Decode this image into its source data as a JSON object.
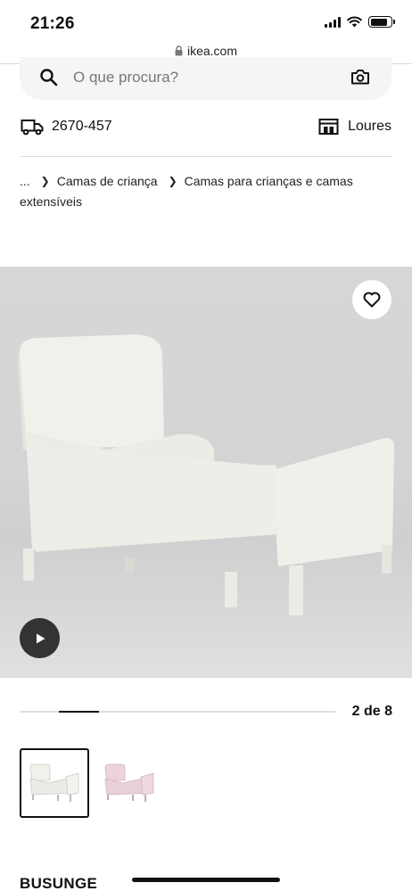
{
  "status_bar": {
    "time": "21:26"
  },
  "browser": {
    "url": "ikea.com"
  },
  "search": {
    "placeholder": "O que procura?"
  },
  "delivery": {
    "postcode": "2670-457"
  },
  "store": {
    "name": "Loures"
  },
  "breadcrumb": {
    "ellipsis": "...",
    "items": [
      "Camas de criança",
      "Camas para crianças e camas extensíveis"
    ]
  },
  "gallery": {
    "current": 2,
    "total": 8,
    "counter_text": "2 de 8",
    "progress": {
      "start_fraction": 0.125,
      "end_fraction": 0.25
    },
    "thumbnails": [
      {
        "name": "white-bed",
        "color": "#f2f2ee",
        "selected": true
      },
      {
        "name": "pink-bed",
        "color": "#efd3dc",
        "selected": false
      }
    ]
  },
  "product": {
    "name": "BUSUNGE"
  },
  "colors": {
    "text": "#111111",
    "image_background": "#d5d5d5",
    "play_button": "#333333"
  }
}
